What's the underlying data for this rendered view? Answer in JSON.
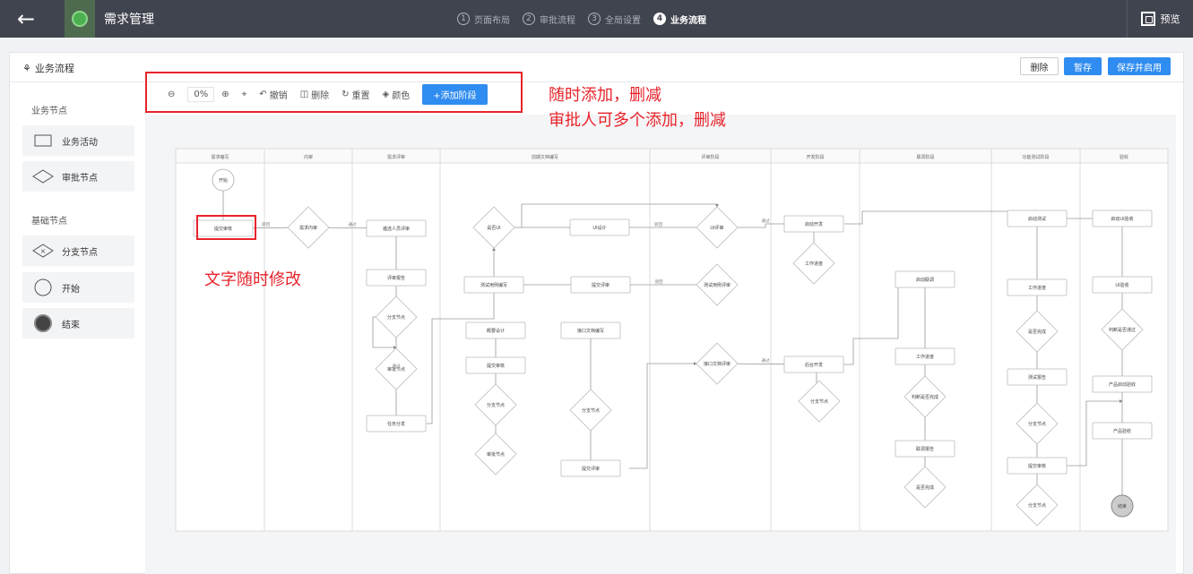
{
  "topbar": {
    "app_title": "需求管理",
    "steps": [
      {
        "num": "1",
        "label": "页面布局"
      },
      {
        "num": "2",
        "label": "审批流程"
      },
      {
        "num": "3",
        "label": "全局设置"
      },
      {
        "num": "4",
        "label": "业务流程"
      }
    ],
    "preview_label": "预览"
  },
  "header": {
    "title": "业务流程",
    "delete_label": "删除",
    "save_label": "暂存",
    "save_enable_label": "保存并启用"
  },
  "palette": {
    "groups": [
      {
        "title": "业务节点",
        "items": [
          {
            "label": "业务活动",
            "icon": "rect-icon"
          },
          {
            "label": "审批节点",
            "icon": "diamond-icon"
          }
        ]
      },
      {
        "title": "基础节点",
        "items": [
          {
            "label": "分支节点",
            "icon": "branch-diamond-icon"
          },
          {
            "label": "开始",
            "icon": "circle-icon"
          },
          {
            "label": "结束",
            "icon": "filled-circle-icon"
          }
        ]
      }
    ]
  },
  "toolbar": {
    "zoom_value": "0%",
    "undo_label": "撤销",
    "delete_label": "删除",
    "reset_label": "重置",
    "color_label": "颜色",
    "add_stage_label": "+添加阶段"
  },
  "annotations": {
    "line1": "随时添加，删减",
    "line2": "审批人可多个添加，删减",
    "line3": "文字随时修改"
  },
  "flow": {
    "lanes": [
      "需求编写",
      "内审",
      "需求评审",
      "前期文档编写",
      "评审阶段",
      "开发阶段",
      "联调阶段",
      "功能测试阶段",
      "验收"
    ],
    "nodes": {
      "start": "开始",
      "submit_review": "提交审核",
      "req_internal": "需求内审",
      "select_reviewer": "遴选人员评审",
      "review_report": "评审报告",
      "branch1": "分支节点",
      "approve1": "审批节点",
      "task_assign": "任务分发",
      "is_ui": "是否UI",
      "ui_design": "UI设计",
      "ui_review": "UI评审",
      "test_case": "测试用例编写",
      "submit_review2": "提交评审",
      "test_case_review": "测试用例评审",
      "schema_design": "概要设计",
      "submit_audit": "提交审核",
      "branch2": "分支节点",
      "approve2": "审批节点",
      "api_doc": "接口文档编写",
      "branch3": "分支节点",
      "submit_review3": "提交评审",
      "api_doc_review": "接口文档评审",
      "start_dev": "启动开发",
      "work_progress1": "工作进度",
      "backend_dev": "后台开发",
      "branch4": "分支节点",
      "start_joint": "启动联调",
      "work_progress2": "工作进度",
      "judge_done1": "判断是否完成",
      "joint_report": "联调报告",
      "is_done1": "是否完成",
      "start_test": "启动测试",
      "work_progress3": "工作进度",
      "is_done2": "是否完成",
      "test_report": "测试报告",
      "branch5": "分支节点",
      "submit_audit2": "提交审核",
      "branch6": "分支节点",
      "start_ui_accept": "启动UI验收",
      "ui_accept": "UI验收",
      "judge_pass": "判断是否通过",
      "product_accept": "产品启动验收",
      "product_check": "产品验收",
      "end": "结束"
    },
    "edge_labels": {
      "reject": "驳回",
      "pass": "通过"
    }
  }
}
